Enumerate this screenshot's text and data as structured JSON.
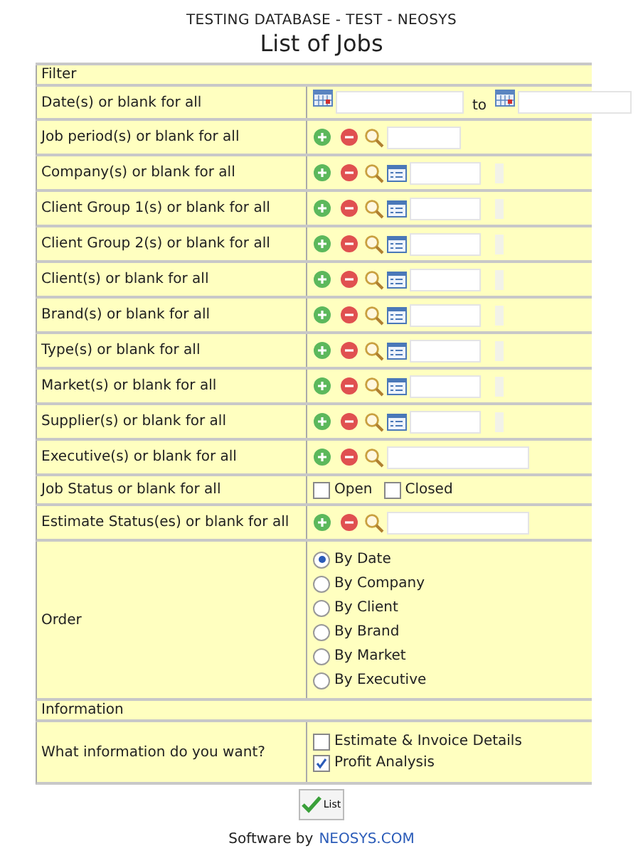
{
  "header": {
    "database": "TESTING DATABASE - TEST - NEOSYS",
    "title": "List of Jobs"
  },
  "filter": {
    "heading": "Filter",
    "rows": [
      {
        "kind": "date_range",
        "label": "Date(s) or blank for all",
        "separator": "to"
      },
      {
        "kind": "lookup",
        "label": "Job period(s) or blank for all",
        "wide": false
      },
      {
        "kind": "lookup_list",
        "label": "Company(s) or blank for all"
      },
      {
        "kind": "lookup_list",
        "label": "Client Group 1(s) or blank for all"
      },
      {
        "kind": "lookup_list",
        "label": "Client Group 2(s) or blank for all"
      },
      {
        "kind": "lookup_list",
        "label": "Client(s) or blank for all"
      },
      {
        "kind": "lookup_list",
        "label": "Brand(s) or blank for all"
      },
      {
        "kind": "lookup_list",
        "label": "Type(s) or blank for all"
      },
      {
        "kind": "lookup_list",
        "label": "Market(s)  or blank for all"
      },
      {
        "kind": "lookup_list",
        "label": "Supplier(s) or blank for all"
      },
      {
        "kind": "lookup",
        "label": "Executive(s) or blank for all",
        "wide": true
      },
      {
        "kind": "checkboxes",
        "label": "Job Status or blank for all",
        "options": [
          {
            "label": "Open",
            "checked": false
          },
          {
            "label": "Closed",
            "checked": false
          }
        ]
      },
      {
        "kind": "lookup",
        "label": "Estimate Status(es) or blank for all",
        "wide": true
      },
      {
        "kind": "radios",
        "label": "Order",
        "options": [
          {
            "label": "By Date",
            "selected": true
          },
          {
            "label": "By Company",
            "selected": false
          },
          {
            "label": "By Client",
            "selected": false
          },
          {
            "label": "By Brand",
            "selected": false
          },
          {
            "label": "By Market",
            "selected": false
          },
          {
            "label": "By Executive",
            "selected": false
          }
        ]
      }
    ]
  },
  "information": {
    "heading": "Information",
    "rows": [
      {
        "kind": "checkboxes_stacked",
        "label": "What information do you want?",
        "options": [
          {
            "label": "Estimate & Invoice Details",
            "checked": false
          },
          {
            "label": "Profit Analysis",
            "checked": true
          }
        ]
      }
    ]
  },
  "button": {
    "label": "List"
  },
  "footer": {
    "text": "Software by",
    "link": "NEOSYS.COM"
  }
}
